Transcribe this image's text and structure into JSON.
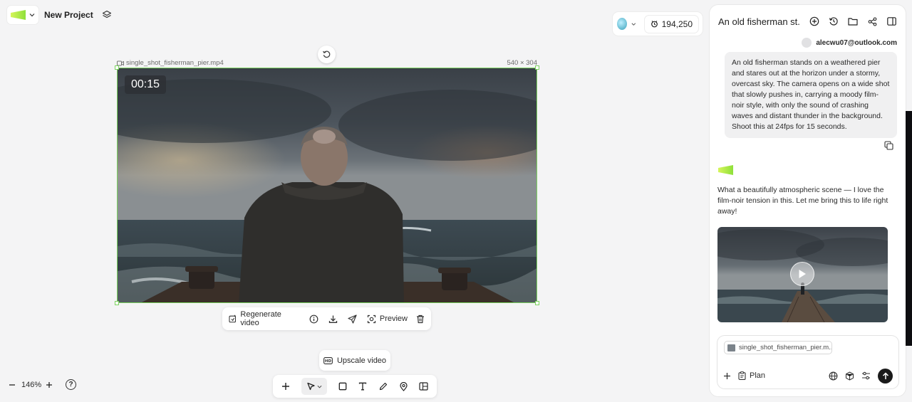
{
  "header": {
    "project_name": "New Project",
    "credits": "194,250"
  },
  "canvas": {
    "file_name": "single_shot_fisherman_pier.mp4",
    "dimensions": "540 × 304",
    "duration": "00:15",
    "zoom": "146%"
  },
  "action_bar": {
    "regenerate_label": "Regenerate video",
    "preview_label": "Preview"
  },
  "upscale_label": "Upscale video",
  "toolbar": {
    "tools": [
      "add",
      "select",
      "rectangle",
      "text",
      "pen",
      "pin",
      "layout"
    ]
  },
  "chat": {
    "title": "An old fisherman st...",
    "user_email": "alecwu07@outlook.com",
    "user_message": "An old fisherman stands on a weathered pier and stares out at the horizon under a stormy, overcast sky. The camera opens on a wide shot that slowly pushes in, carrying a moody film-noir style, with only the sound of crashing waves and distant thunder in the background. Shoot this at 24fps for 15 seconds.",
    "assistant_message": "What a beautifully atmospheric scene — I love the film-noir tension in this. Let me bring this to life right away!",
    "composer": {
      "attachment": "single_shot_fisherman_pier.m...",
      "plan_label": "Plan"
    }
  },
  "colors": {
    "accent_green": "#7bd25f",
    "logo_lime": "#b6f03c",
    "panel_bg": "#ffffff",
    "canvas_bg": "#f4f4f5"
  }
}
